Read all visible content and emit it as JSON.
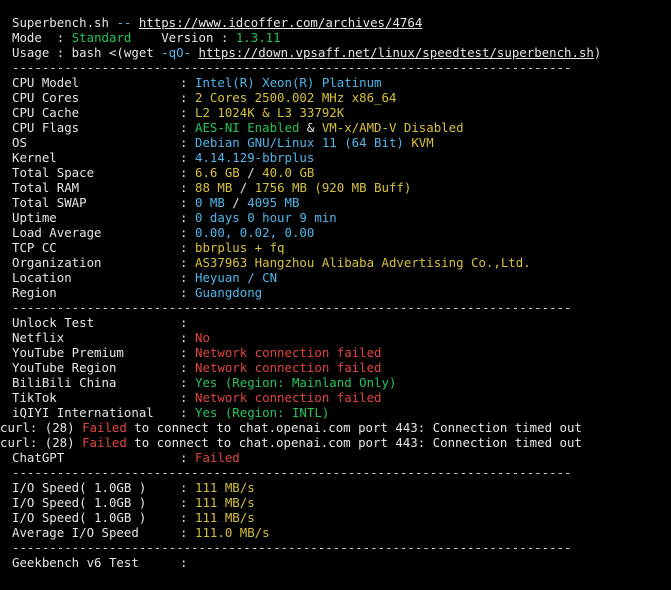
{
  "header": {
    "title_name": "Superbench.sh",
    "title_dash": " -- ",
    "title_url": "https://www.idcoffer.com/archives/4764",
    "mode_label": "Mode  : ",
    "mode_value": "Standard",
    "version_label": "    Version : ",
    "version_value": "1.3.11",
    "usage_label": "Usage : bash <(wget ",
    "usage_flag": "-qO-",
    "usage_url": "https://down.vpsaff.net/linux/speedtest/superbench.sh",
    "usage_end": ")"
  },
  "separator": "---------------------------------------------------------------------------",
  "sysinfo": {
    "cpu_model": {
      "label": "CPU Model",
      "value": "Intel(R) Xeon(R) Platinum"
    },
    "cpu_cores": {
      "label": "CPU Cores",
      "value": "2 Cores 2500.002 MHz x86_64"
    },
    "cpu_cache": {
      "label": "CPU Cache",
      "value": "L2 1024K & L3 33792K"
    },
    "cpu_flags": {
      "label": "CPU Flags",
      "v1": "AES-NI Enabled",
      "amp": " & ",
      "v2": "VM-x/AMD-V Disabled"
    },
    "os": {
      "label": "OS",
      "v1": "Debian GNU/Linux 11 (64 Bit)",
      "v2": " KVM"
    },
    "kernel": {
      "label": "Kernel",
      "value": "4.14.129-bbrplus"
    },
    "total_space": {
      "label": "Total Space",
      "v1": "6.6 GB",
      "sep": " / ",
      "v2": "40.0 GB"
    },
    "total_ram": {
      "label": "Total RAM",
      "v1": "88 MB",
      "sep": " / ",
      "v2": "1756 MB",
      "v3": " (920 MB Buff)"
    },
    "total_swap": {
      "label": "Total SWAP",
      "v1": "0 MB",
      "sep": " / ",
      "v2": "4095 MB"
    },
    "uptime": {
      "label": "Uptime",
      "value": "0 days 0 hour 9 min"
    },
    "load_average": {
      "label": "Load Average",
      "value": "0.00, 0.02, 0.00"
    },
    "tcp_cc": {
      "label": "TCP CC",
      "value": "bbrplus + fq"
    },
    "organization": {
      "label": "Organization",
      "value": "AS37963 Hangzhou Alibaba Advertising Co.,Ltd."
    },
    "location": {
      "label": "Location",
      "value": "Heyuan / CN"
    },
    "region": {
      "label": "Region",
      "value": "Guangdong"
    }
  },
  "unlock": {
    "title": {
      "label": "Unlock Test",
      "value": ""
    },
    "netflix": {
      "label": "Netflix",
      "value": "No"
    },
    "youtube_premium": {
      "label": "YouTube Premium",
      "value": "Network connection failed"
    },
    "youtube_region": {
      "label": "YouTube Region",
      "value": "Network connection failed"
    },
    "bilibili": {
      "label": "BiliBili China",
      "value": "Yes (Region: Mainland Only)"
    },
    "tiktok": {
      "label": "TikTok",
      "value": "Network connection failed"
    },
    "iqiyi": {
      "label": "iQIYI International",
      "value": "Yes (Region: INTL)"
    },
    "curl_prefix": "curl: (28) ",
    "curl_failed": "Failed",
    "curl_rest": " to connect to chat.openai.com port 443: Connection timed out",
    "chatgpt": {
      "label": "ChatGPT",
      "value": "Failed"
    }
  },
  "io": {
    "io1": {
      "label": "I/O Speed( 1.0GB )",
      "value": "111 MB/s"
    },
    "io2": {
      "label": "I/O Speed( 1.0GB )",
      "value": "111 MB/s"
    },
    "io3": {
      "label": "I/O Speed( 1.0GB )",
      "value": "111 MB/s"
    },
    "avg": {
      "label": "Average I/O Speed",
      "value": "111.0 MB/s"
    }
  },
  "geekbench": {
    "label": "Geekbench v6 Test",
    "value": ""
  },
  "colon": ":",
  "colors": {
    "background": "#000000",
    "text": "#e6e6e6",
    "blue": "#4fb6ea",
    "green": "#24c45a",
    "yellow": "#d6c13b",
    "red": "#e0453f"
  }
}
